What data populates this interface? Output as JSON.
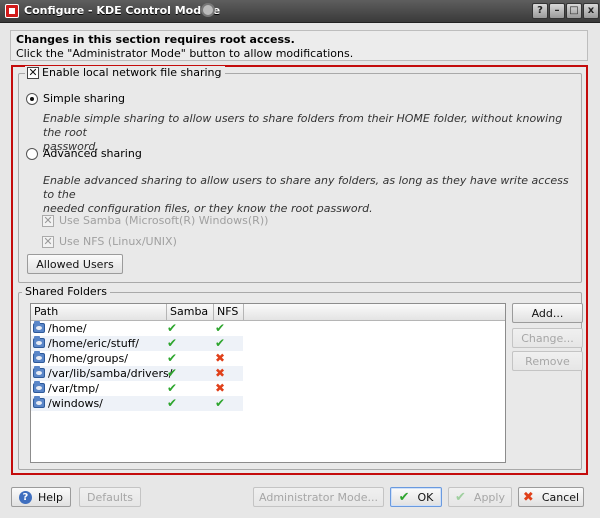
{
  "window": {
    "title": "Configure - KDE Control Module",
    "controls": {
      "help": "?",
      "minimize": "–",
      "maximize": "□",
      "close": "x"
    }
  },
  "notice": {
    "title": "Changes in this section requires root access.",
    "subtitle": "Click the \"Administrator Mode\" button to allow modifications."
  },
  "sharing": {
    "enable_label": "Enable local network file sharing",
    "enable_checked": true,
    "simple_label": "Simple sharing",
    "simple_selected": true,
    "simple_desc_1": "Enable simple sharing to allow users to share folders from their HOME folder, without knowing the root",
    "simple_desc_2": "password.",
    "advanced_label": "Advanced sharing",
    "advanced_selected": false,
    "advanced_desc_1": "Enable advanced sharing to allow users to share any folders, as long as they have write access to the",
    "advanced_desc_2": "needed configuration files, or they know the root password.",
    "samba_label": "Use Samba (Microsoft(R) Windows(R))",
    "nfs_label": "Use NFS (Linux/UNIX)",
    "allowed_users_button": "Allowed Users"
  },
  "shared_folders": {
    "title": "Shared Folders",
    "columns": [
      "Path",
      "Samba",
      "NFS"
    ],
    "rows": [
      {
        "path": "/home/",
        "samba": "✔",
        "nfs": "✔"
      },
      {
        "path": "/home/eric/stuff/",
        "samba": "✔",
        "nfs": "✔"
      },
      {
        "path": "/home/groups/",
        "samba": "✔",
        "nfs": "✖"
      },
      {
        "path": "/var/lib/samba/drivers/",
        "samba": "✔",
        "nfs": "✖"
      },
      {
        "path": "/var/tmp/",
        "samba": "✔",
        "nfs": "✖"
      },
      {
        "path": "/windows/",
        "samba": "✔",
        "nfs": "✔"
      }
    ],
    "add_button": "Add...",
    "change_button": "Change...",
    "remove_button": "Remove"
  },
  "bottom": {
    "help": "Help",
    "defaults": "Defaults",
    "admin_mode": "Administrator Mode...",
    "ok": "OK",
    "apply": "Apply",
    "cancel": "Cancel"
  },
  "icons": {
    "check": "✔",
    "cross": "✖",
    "checkbox_mark": "✕"
  },
  "colors": {
    "highlight_frame": "#c40c0c",
    "yes": "#2ea52e",
    "no": "#e0401a"
  }
}
